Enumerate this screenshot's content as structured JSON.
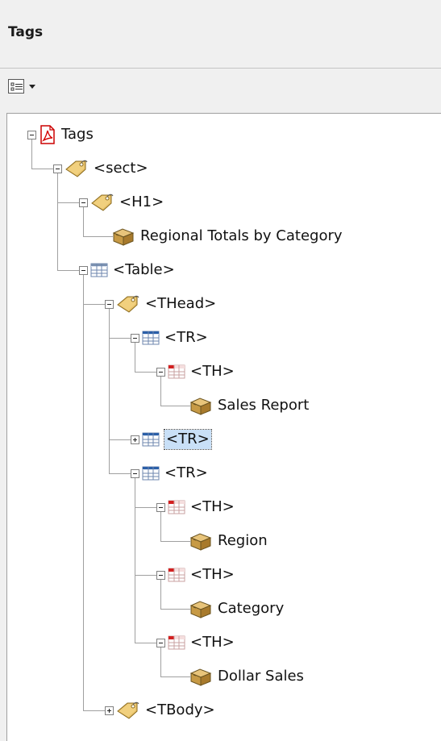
{
  "panel": {
    "title": "Tags",
    "options_icon": "options-menu-icon"
  },
  "tree": {
    "nodes": [
      {
        "label": "Tags",
        "icon": "pdf-icon",
        "expander": "minus"
      },
      {
        "label": "<sect>",
        "icon": "tag-icon",
        "expander": "minus"
      },
      {
        "label": "<H1>",
        "icon": "tag-icon",
        "expander": "minus"
      },
      {
        "label": "Regional Totals by Category",
        "icon": "content-box-icon",
        "expander": "none"
      },
      {
        "label": "<Table>",
        "icon": "table-icon",
        "expander": "minus"
      },
      {
        "label": "<THead>",
        "icon": "tag-icon",
        "expander": "minus"
      },
      {
        "label": "<TR>",
        "icon": "table-row-icon",
        "expander": "minus"
      },
      {
        "label": "<TH>",
        "icon": "table-header-cell-icon",
        "expander": "minus"
      },
      {
        "label": "Sales Report",
        "icon": "content-box-icon",
        "expander": "none"
      },
      {
        "label": "<TR>",
        "icon": "table-row-icon",
        "expander": "plus",
        "selected": true
      },
      {
        "label": "<TR>",
        "icon": "table-row-icon",
        "expander": "minus"
      },
      {
        "label": "<TH>",
        "icon": "table-header-cell-icon",
        "expander": "minus"
      },
      {
        "label": "Region",
        "icon": "content-box-icon",
        "expander": "none"
      },
      {
        "label": "<TH>",
        "icon": "table-header-cell-icon",
        "expander": "minus"
      },
      {
        "label": "Category",
        "icon": "content-box-icon",
        "expander": "none"
      },
      {
        "label": "<TH>",
        "icon": "table-header-cell-icon",
        "expander": "minus"
      },
      {
        "label": "Dollar Sales",
        "icon": "content-box-icon",
        "expander": "none"
      },
      {
        "label": "<TBody>",
        "icon": "tag-icon",
        "expander": "plus"
      }
    ]
  }
}
